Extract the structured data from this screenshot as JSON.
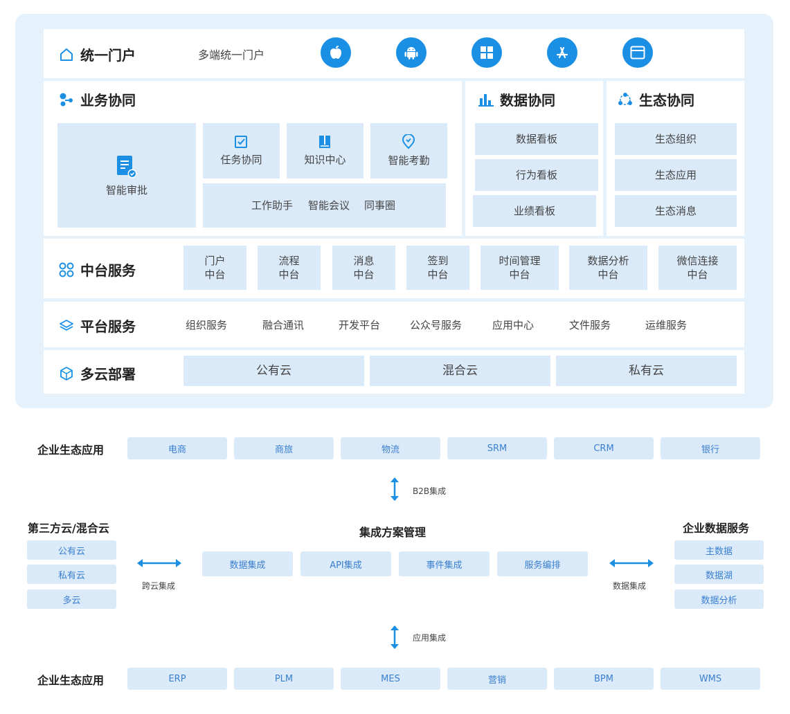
{
  "portal": {
    "title": "统一门户",
    "subtitle": "多端统一门户",
    "icons": [
      "apple-icon",
      "android-icon",
      "windows-icon",
      "app-store-icon",
      "browser-icon"
    ]
  },
  "business": {
    "title": "业务协同",
    "approval": "智能审批",
    "task": "任务协同",
    "knowledge": "知识中心",
    "attendance": "智能考勤",
    "assistant": "工作助手",
    "meeting": "智能会议",
    "circle": "同事圈"
  },
  "data": {
    "title": "数据协同",
    "items": [
      "数据看板",
      "行为看板",
      "业绩看板"
    ]
  },
  "eco": {
    "title": "生态协同",
    "items": [
      "生态组织",
      "生态应用",
      "生态消息"
    ]
  },
  "middle": {
    "title": "中台服务",
    "items": [
      {
        "l1": "门户",
        "l2": "中台"
      },
      {
        "l1": "流程",
        "l2": "中台"
      },
      {
        "l1": "消息",
        "l2": "中台"
      },
      {
        "l1": "签到",
        "l2": "中台"
      },
      {
        "l1": "时间管理",
        "l2": "中台"
      },
      {
        "l1": "数据分析",
        "l2": "中台"
      },
      {
        "l1": "微信连接",
        "l2": "中台"
      }
    ]
  },
  "platform": {
    "title": "平台服务",
    "items": [
      "组织服务",
      "融合通讯",
      "开发平台",
      "公众号服务",
      "应用中心",
      "文件服务",
      "运维服务"
    ]
  },
  "cloud": {
    "title": "多云部署",
    "items": [
      "公有云",
      "混合云",
      "私有云"
    ]
  },
  "integration": {
    "top_label": "企业生态应用",
    "top_items": [
      "电商",
      "商旅",
      "物流",
      "SRM",
      "CRM",
      "银行"
    ],
    "b2b": "B2B集成",
    "left_title": "第三方云/混合云",
    "left_items": [
      "公有云",
      "私有云",
      "多云"
    ],
    "cross": "跨云集成",
    "center_title": "集成方案管理",
    "center_items": [
      "数据集成",
      "API集成",
      "事件集成",
      "服务编排"
    ],
    "data_int": "数据集成",
    "right_title": "企业数据服务",
    "right_items": [
      "主数据",
      "数据湖",
      "数据分析"
    ],
    "app_int": "应用集成",
    "bottom_label": "企业生态应用",
    "bottom_items": [
      "ERP",
      "PLM",
      "MES",
      "营销",
      "BPM",
      "WMS"
    ]
  },
  "colors": {
    "accent": "#1a8fe3",
    "box": "#dbeaf8",
    "panel": "#e5f2fc"
  }
}
